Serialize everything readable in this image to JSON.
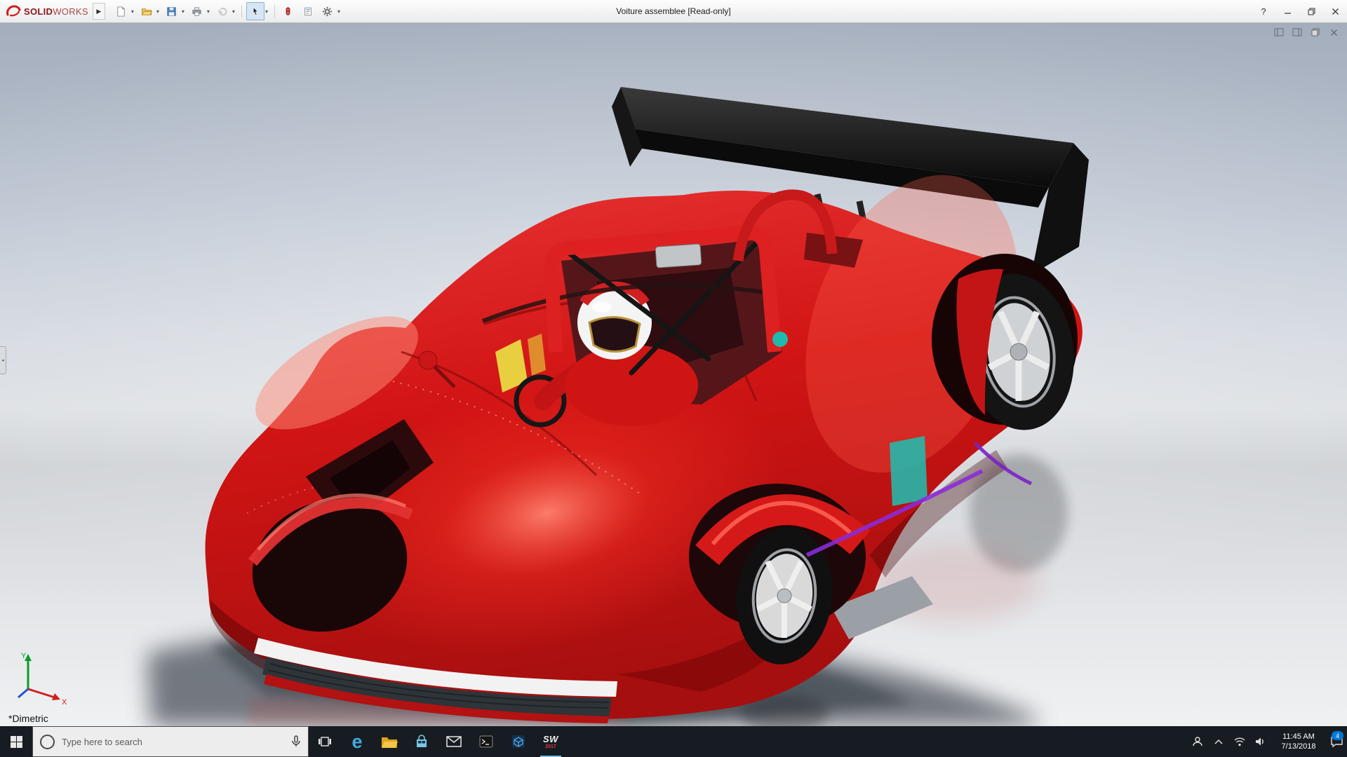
{
  "colors": {
    "car_red": "#d01616",
    "car_red_dark": "#9a0d0d",
    "wing_black": "#141414",
    "accent_purple": "#8a2bd8",
    "accent_teal": "#1fb9ad",
    "accent_yellow": "#e7cf3f",
    "taskbar_bg": "#171c22",
    "titlebar_bg": "#f0f0f0"
  },
  "titlebar": {
    "brand_solid": "SOLID",
    "brand_works": "WORKS",
    "title": "Voiture assemblee [Read-only]",
    "help_label": "?",
    "toolbar_icons": [
      "new-document",
      "open",
      "save",
      "print",
      "undo",
      "select",
      "rebuild",
      "file-properties",
      "options"
    ]
  },
  "viewport": {
    "view_label": "*Dimetric",
    "axes": {
      "x": "X",
      "y": "Y"
    },
    "doc_controls": [
      "pane-preview",
      "pane-display",
      "restore",
      "close"
    ]
  },
  "taskbar": {
    "search": {
      "placeholder": "Type here to search"
    },
    "apps": [
      "start",
      "cortana-search",
      "task-view",
      "edge",
      "file-explorer",
      "store",
      "mail",
      "command-prompt",
      "cad-viewer",
      "solidworks-2017"
    ],
    "sw": {
      "text": "SW",
      "year": "2017"
    },
    "tray": [
      "people",
      "hidden-icons",
      "network",
      "volume",
      "clock",
      "action-center"
    ],
    "action_badge": "4",
    "clock": {
      "time": "11:45 AM",
      "date": "7/13/2018"
    }
  }
}
